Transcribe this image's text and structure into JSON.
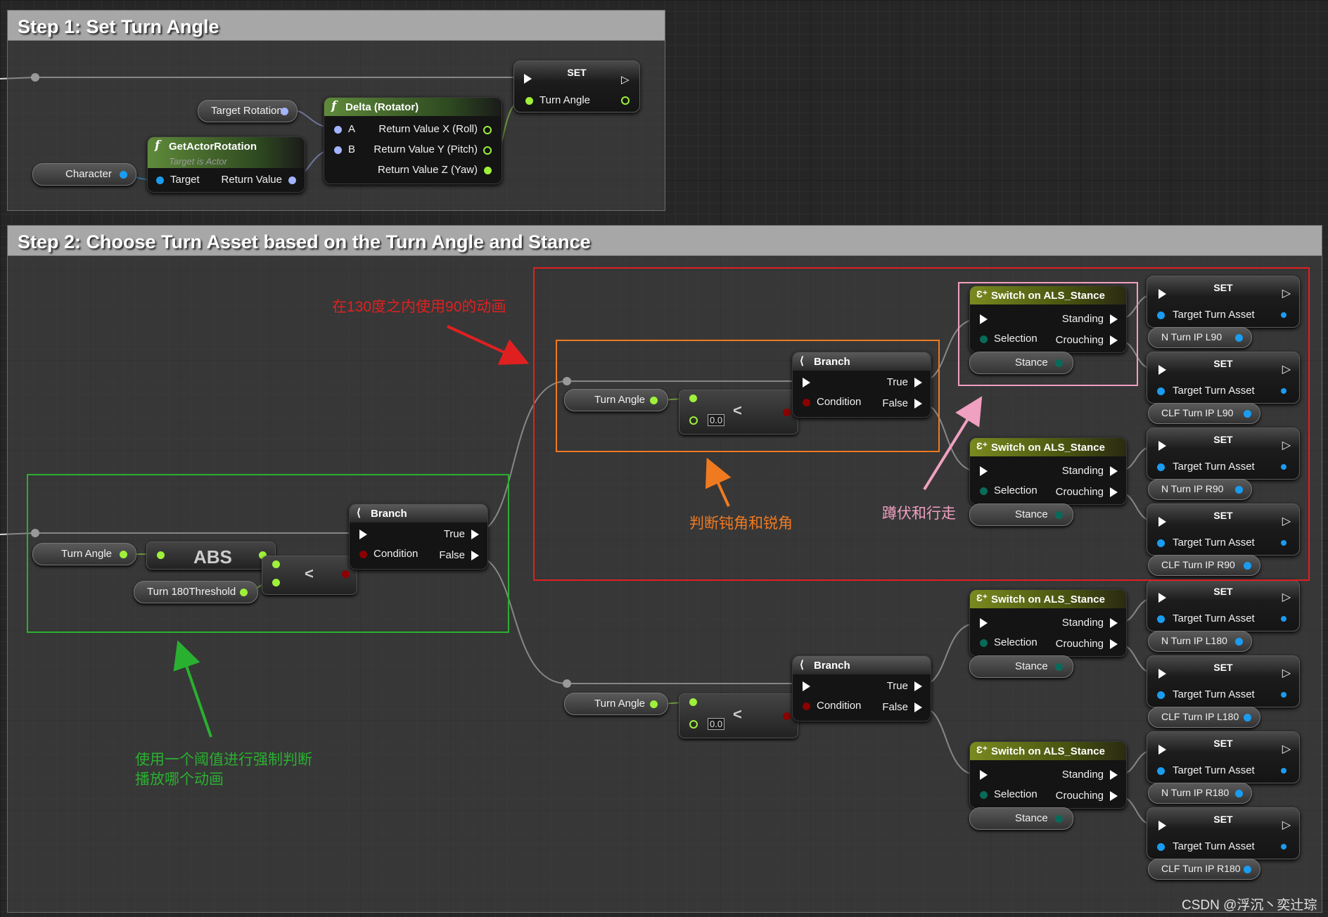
{
  "step1": {
    "title": "Step 1: Set Turn Angle"
  },
  "step2": {
    "title": "Step 2: Choose Turn Asset based on the Turn Angle and Stance"
  },
  "s1": {
    "set_title": "SET",
    "set_pin": "Turn Angle",
    "target_rotation": "Target Rotation",
    "character": "Character",
    "get_actor_rotation": {
      "title": "GetActorRotation",
      "subtitle": "Target is Actor",
      "target": "Target",
      "return": "Return Value"
    },
    "delta": {
      "title": "Delta (Rotator)",
      "a": "A",
      "b": "B",
      "x": "Return Value X (Roll)",
      "y": "Return Value Y (Pitch)",
      "z": "Return Value Z (Yaw)"
    }
  },
  "s2": {
    "turn_angle": "Turn Angle",
    "abs": "ABS",
    "threshold": "Turn 180Threshold",
    "less": "<",
    "zero": "0.0",
    "branch": {
      "title": "Branch",
      "cond": "Condition",
      "true": "True",
      "false": "False"
    },
    "switch": {
      "title": "Switch on ALS_Stance",
      "selection": "Selection",
      "standing": "Standing",
      "crouching": "Crouching",
      "stance": "Stance"
    },
    "set": {
      "title": "SET",
      "pin": "Target Turn Asset"
    },
    "assets": [
      "N Turn IP L90",
      "CLF Turn IP L90",
      "N Turn IP R90",
      "CLF Turn IP R90",
      "N Turn IP L180",
      "CLF Turn IP L180",
      "N Turn IP R180",
      "CLF Turn IP R180"
    ]
  },
  "annotations": {
    "red": "在130度之内使用90的动画",
    "orange": "判断钝角和锐角",
    "pink": "蹲伏和行走",
    "green1": "使用一个阈值进行强制判断",
    "green2": "播放哪个动画"
  },
  "watermark": "CSDN @浮沉丶奕辻琮",
  "colors": {
    "float": "#9ff03a",
    "rotator": "#a3b4ff",
    "object": "#1a9cf0",
    "bool": "#8c0000",
    "enum": "#0a6a5a",
    "red_box": "#e02020",
    "orange_box": "#f07a20",
    "pink_box": "#f0a0c0",
    "green_box": "#2ab030"
  }
}
